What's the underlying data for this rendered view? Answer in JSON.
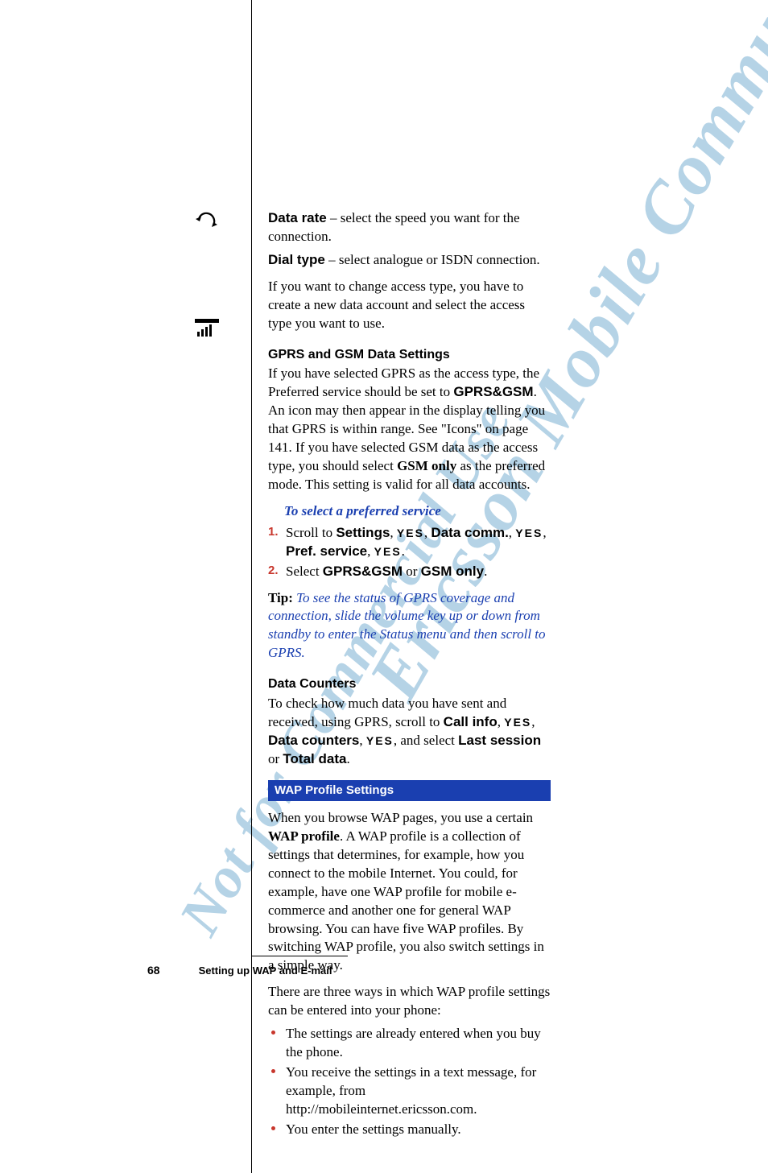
{
  "watermarks": {
    "large": "Ericsson Mobile Communications AB",
    "small": "Not for Commercial Use"
  },
  "defs": {
    "data_rate_label": "Data rate",
    "data_rate_text": " – select the speed you want for the connection.",
    "dial_type_label": "Dial type",
    "dial_type_text": " – select analogue or ISDN connection.",
    "change_access": "If you want to change access type, you have to create a new data account and select the access type you want to use."
  },
  "gprs": {
    "heading": "GPRS and GSM Data Settings",
    "body_pre": "If you have selected GPRS as the access type, the Preferred service should be set to ",
    "body_bold1": "GPRS&GSM",
    "body_mid": ". An icon may then appear in the display telling you that GPRS is within range. See \"Icons\" on page 141. If you have selected GSM data as the access type, you should select ",
    "body_bold2": "GSM only",
    "body_post": " as the preferred mode. This setting is valid for all data accounts.",
    "sub_heading": "To select a preferred service",
    "step1_num": "1.",
    "step1_a": "Scroll to ",
    "step1_settings": "Settings",
    "step1_yes": "YES",
    "step1_datacomm": "Data comm.",
    "step1_pref": "Pref. service",
    "step2_num": "2.",
    "step2_a": "Select ",
    "step2_opt1": "GPRS&GSM",
    "step2_or": " or ",
    "step2_opt2": "GSM only",
    "tip_label": "Tip: ",
    "tip_text": "To see the status of GPRS coverage and connection, slide the volume key up or down from standby to enter the Status menu and then scroll to GPRS."
  },
  "counters": {
    "heading": "Data Counters",
    "pre": "To check how much data you have sent and received, using GPRS, scroll to ",
    "callinfo": "Call info",
    "yes": "YES",
    "datacounters": "Data counters",
    "select": ", and select ",
    "last": "Last session",
    "or": " or ",
    "total": "Total data"
  },
  "wap": {
    "bar": "WAP Profile Settings",
    "p1_pre": "When you browse WAP pages, you use a certain ",
    "p1_bold": "WAP profile",
    "p1_post": ". A WAP profile is a collection of settings that determines, for example, how you connect to the mobile Internet. You could, for example, have one WAP profile for mobile e-commerce and another one for general WAP browsing. You can have five WAP profiles. By switching WAP profile, you also switch settings in a simple way.",
    "p2": "There are three ways in which WAP profile settings can be entered into your phone:",
    "b1": "The settings are already entered when you buy the phone.",
    "b2": "You receive the settings in a text message, for example, from http://mobileinternet.ericsson.com.",
    "b3": "You enter the settings manually."
  },
  "footer": {
    "page": "68",
    "title": "Setting up WAP and E-mail"
  }
}
